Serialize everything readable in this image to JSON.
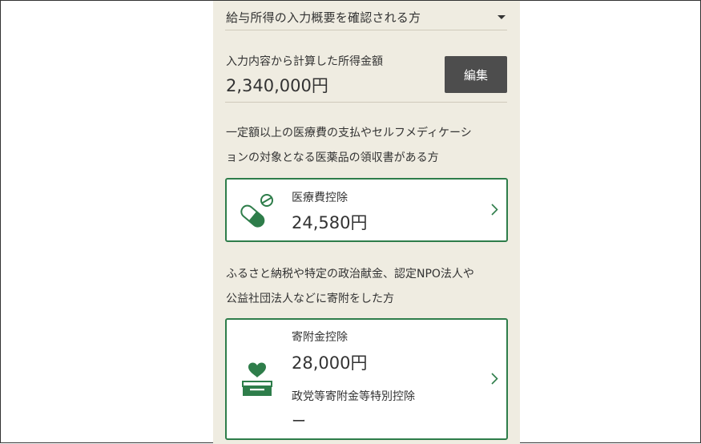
{
  "accordion": {
    "label": "給与所得の入力概要を確認される方",
    "icon": "caret-down-icon"
  },
  "income": {
    "label": "入力内容から計算した所得金額",
    "value": "2,340,000円",
    "edit_label": "編集"
  },
  "medical": {
    "description_line1": "一定額以上の医療費の支払やセルフメディケーシ",
    "description_line2": "ョンの対象となる医薬品の領収書がある方",
    "card_title": "医療費控除",
    "card_amount": "24,580円",
    "icon": "medicine-capsule-icon"
  },
  "donation": {
    "description_line1": "ふるさと納税や特定の政治献金、認定NPO法人や",
    "description_line2": "公益社団法人などに寄附をした方",
    "card_title": "寄附金控除",
    "card_amount": "28,000円",
    "sub_title": "政党等寄附金等特別控除",
    "sub_value": "ー",
    "icon": "heart-donation-box-icon"
  },
  "colors": {
    "accent": "#2e7d4a",
    "panel_background": "#efece1",
    "button": "#4d4d4d"
  }
}
